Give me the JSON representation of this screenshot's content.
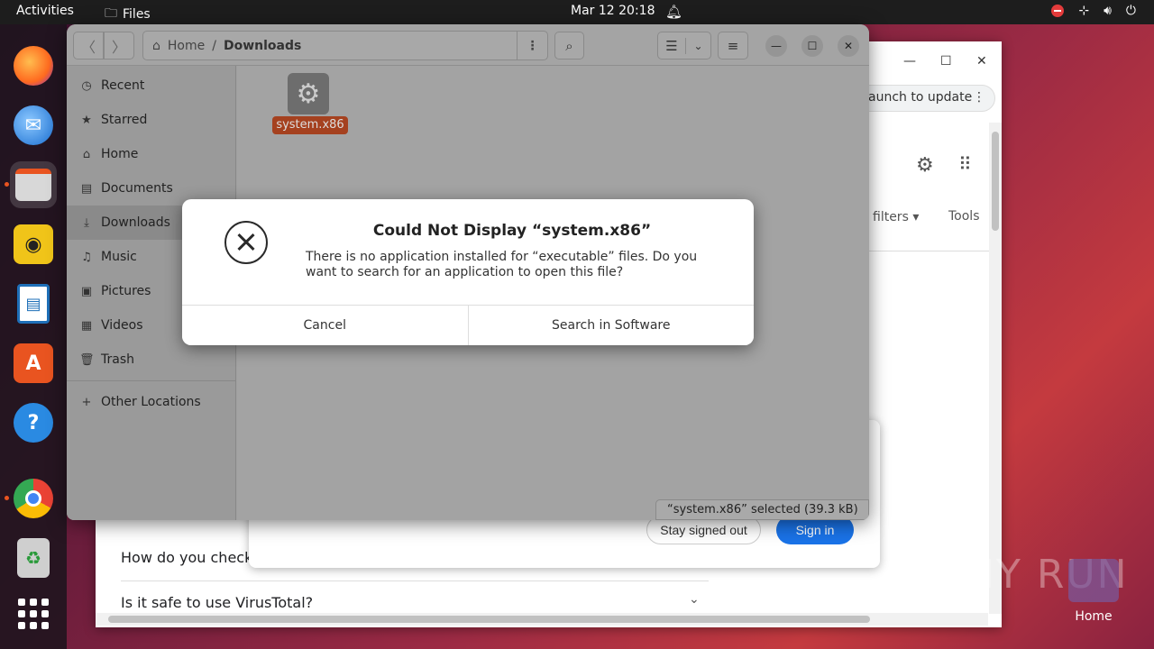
{
  "topbar": {
    "activities": "Activities",
    "app": "Files",
    "clock": "Mar 12  20:18"
  },
  "browser": {
    "relaunch": "aunch to update",
    "filters": "filters",
    "tools": "Tools",
    "faq1": "How do you check i",
    "faq2": "Is it safe to use VirusTotal?",
    "stay_signed_out": "Stay signed out",
    "sign_in": "Sign in"
  },
  "files": {
    "path_home": "Home",
    "path_sep": "/",
    "path_current": "Downloads",
    "sidebar": [
      {
        "label": "Recent",
        "icon": "clock-icon"
      },
      {
        "label": "Starred",
        "icon": "star-icon"
      },
      {
        "label": "Home",
        "icon": "home-icon"
      },
      {
        "label": "Documents",
        "icon": "document-icon"
      },
      {
        "label": "Downloads",
        "icon": "download-icon"
      },
      {
        "label": "Music",
        "icon": "music-icon"
      },
      {
        "label": "Pictures",
        "icon": "picture-icon"
      },
      {
        "label": "Videos",
        "icon": "video-icon"
      },
      {
        "label": "Trash",
        "icon": "trash-icon"
      },
      {
        "label": "Other Locations",
        "icon": "plus-icon"
      }
    ],
    "file_name": "system.x86",
    "status": "“system.x86” selected  (39.3 kB)"
  },
  "dialog": {
    "title": "Could Not Display “system.x86”",
    "message": "There is no application installed for “executable” files. Do you want to search for an application to open this file?",
    "cancel": "Cancel",
    "search": "Search in Software"
  },
  "desktop": {
    "home_label": "Home",
    "watermark": "ANY RUN"
  },
  "colors": {
    "accent": "#e95420",
    "selection": "#a5411f",
    "signin": "#1a73e8"
  }
}
